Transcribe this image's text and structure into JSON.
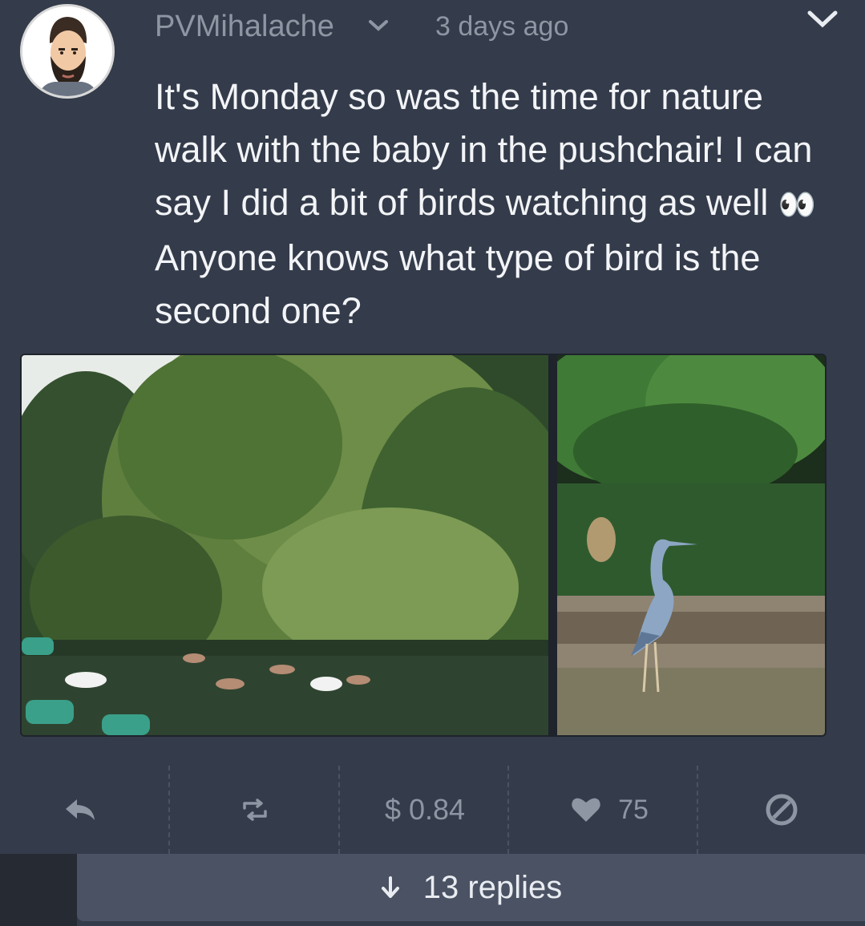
{
  "post": {
    "username": "PVMihalache",
    "timestamp": "3 days ago",
    "text_parts": [
      "It's Monday so was the time for nature walk with the baby in the pushchair! I can say I did a bit of birds watching as well ",
      " Anyone knows what type of bird is the second one?"
    ],
    "emoji": "👀",
    "images": [
      {
        "icon": "swans-on-pond-photo"
      },
      {
        "icon": "heron-on-log-photo"
      }
    ]
  },
  "actions": {
    "payout": "$ 0.84",
    "likes": "75"
  },
  "replies": {
    "label": "13 replies"
  },
  "colors": {
    "background": "#343b4a",
    "muted_text": "#8e95a3",
    "body_text": "#f2f4f7",
    "replies_bar": "#4a5263"
  }
}
